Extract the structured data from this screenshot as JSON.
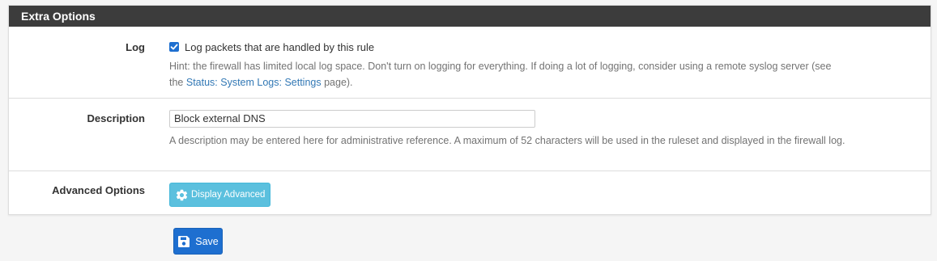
{
  "panel": {
    "title": "Extra Options"
  },
  "log": {
    "label": "Log",
    "checkbox_label": "Log packets that are handled by this rule",
    "checked": true,
    "hint_line1": "Hint: the firewall has limited local log space. Don't turn on logging for everything. If doing a lot of logging, consider using a remote syslog server (see",
    "hint_prefix": "the ",
    "hint_link": "Status: System Logs: Settings",
    "hint_suffix": " page)."
  },
  "description": {
    "label": "Description",
    "value": "Block external DNS",
    "hint": "A description may be entered here for administrative reference. A maximum of 52 characters will be used in the ruleset and displayed in the firewall log."
  },
  "advanced": {
    "label": "Advanced Options",
    "button_label": "Display Advanced",
    "icon": "gear-icon"
  },
  "save": {
    "label": "Save",
    "icon": "save-icon"
  },
  "colors": {
    "heading_bg": "#3c3c3c",
    "primary": "#1e6fd0",
    "info": "#5bc0de",
    "link": "#3278b5"
  }
}
